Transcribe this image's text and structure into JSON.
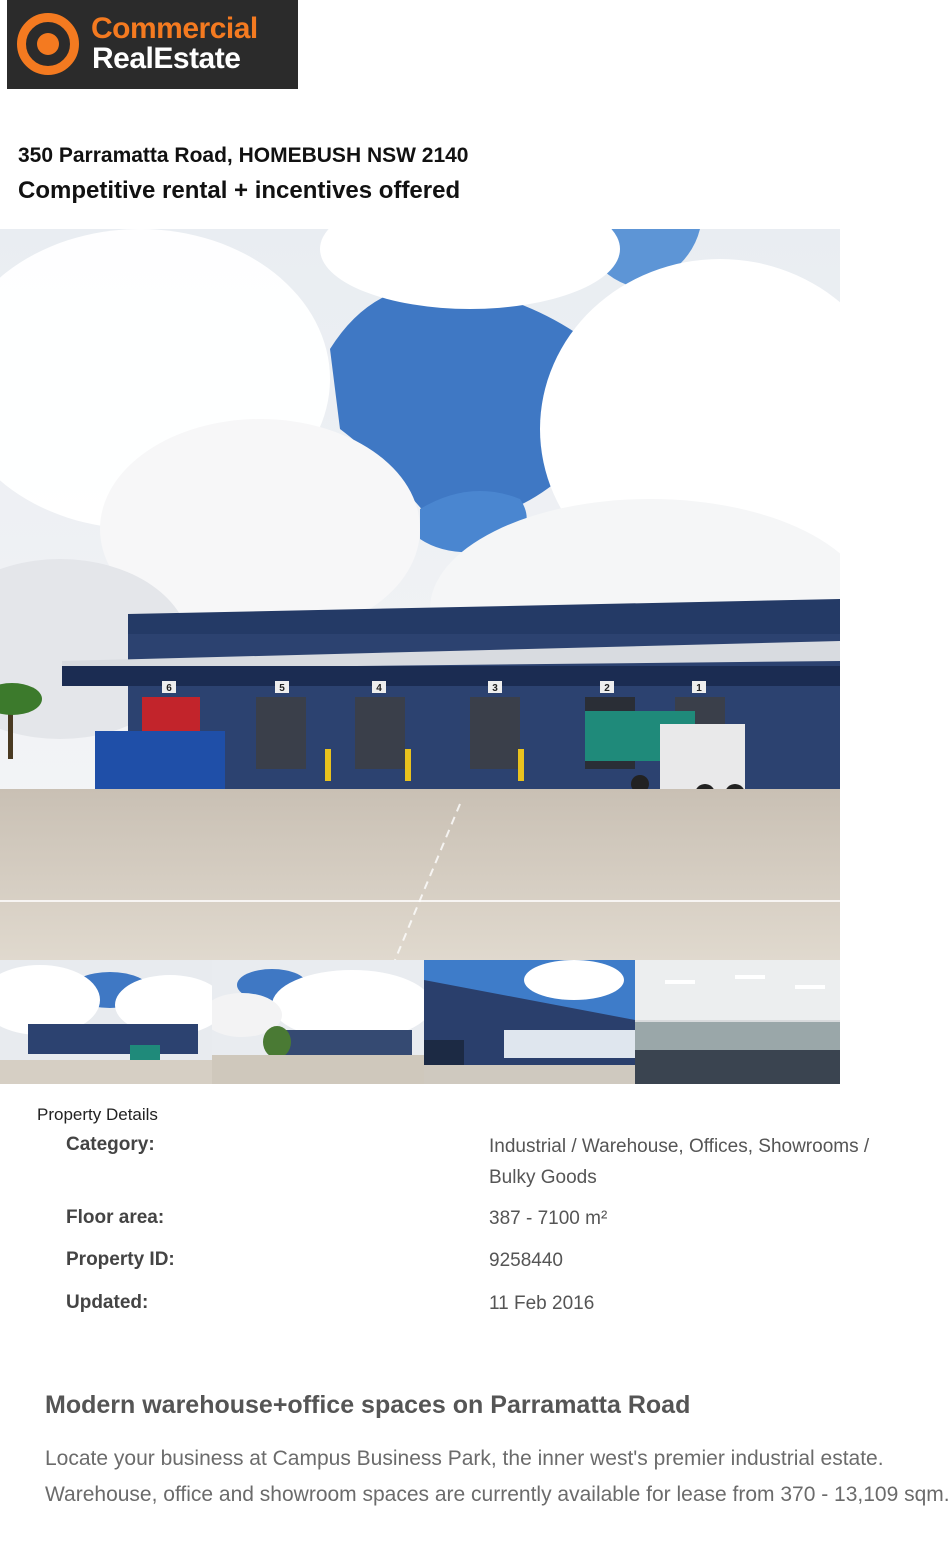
{
  "brand": {
    "name_line1": "Commercial",
    "name_line2": "RealEstate",
    "accent_color": "#f47a20",
    "logo_background": "#2b2b2b"
  },
  "listing": {
    "address": "350 Parramatta Road, HOMEBUSH NSW 2140",
    "tagline": "Competitive rental + incentives offered"
  },
  "gallery": {
    "main_photo": "warehouse-loading-docks-photo",
    "dock_numbers": [
      "6",
      "5",
      "4",
      "3",
      "2",
      "1"
    ],
    "thumbnails": [
      "warehouse-exterior-thumb",
      "business-park-thumb",
      "warehouse-office-facade-thumb",
      "office-interior-thumb"
    ]
  },
  "details": {
    "title": "Property Details",
    "rows": [
      {
        "label": "Category:",
        "value": "Industrial / Warehouse, Offices, Showrooms / Bulky Goods"
      },
      {
        "label": "Floor area:",
        "value": "387 - 7100 m²"
      },
      {
        "label": "Property ID:",
        "value": "9258440"
      },
      {
        "label": "Updated:",
        "value": "11 Feb 2016"
      }
    ]
  },
  "description": {
    "title": "Modern warehouse+office spaces on Parramatta Road",
    "body": "Locate your business at Campus Business Park, the inner west's premier industrial estate. Warehouse, office and showroom spaces are currently available for lease from 370 - 13,109 sqm."
  }
}
